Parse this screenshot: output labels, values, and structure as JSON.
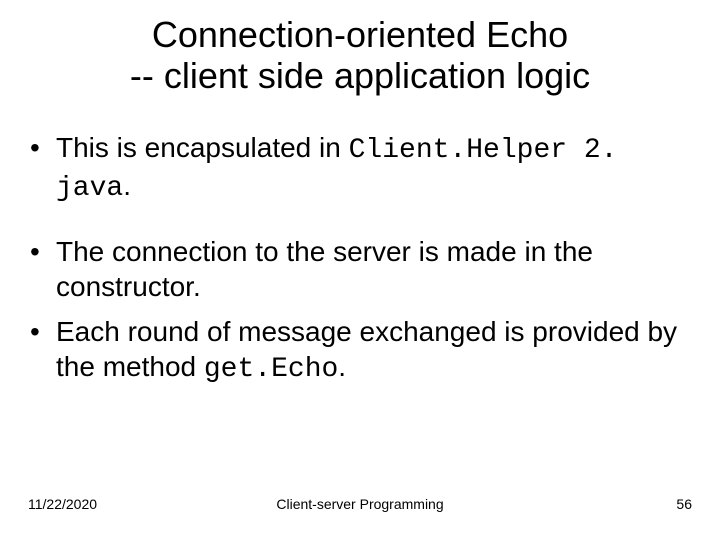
{
  "title_line1": "Connection-oriented Echo",
  "title_line2": "-- client side application logic",
  "bullets": {
    "b1_pre": "This is encapsulated in ",
    "b1_code": "Client.Helper 2. java",
    "b1_post": ".",
    "b2": "The connection to the server is made in the constructor.",
    "b3_pre": "Each round of message exchanged is provided by the method ",
    "b3_code": "get.Echo",
    "b3_post": "."
  },
  "footer": {
    "date": "11/22/2020",
    "center": "Client-server Programming",
    "page": "56"
  }
}
